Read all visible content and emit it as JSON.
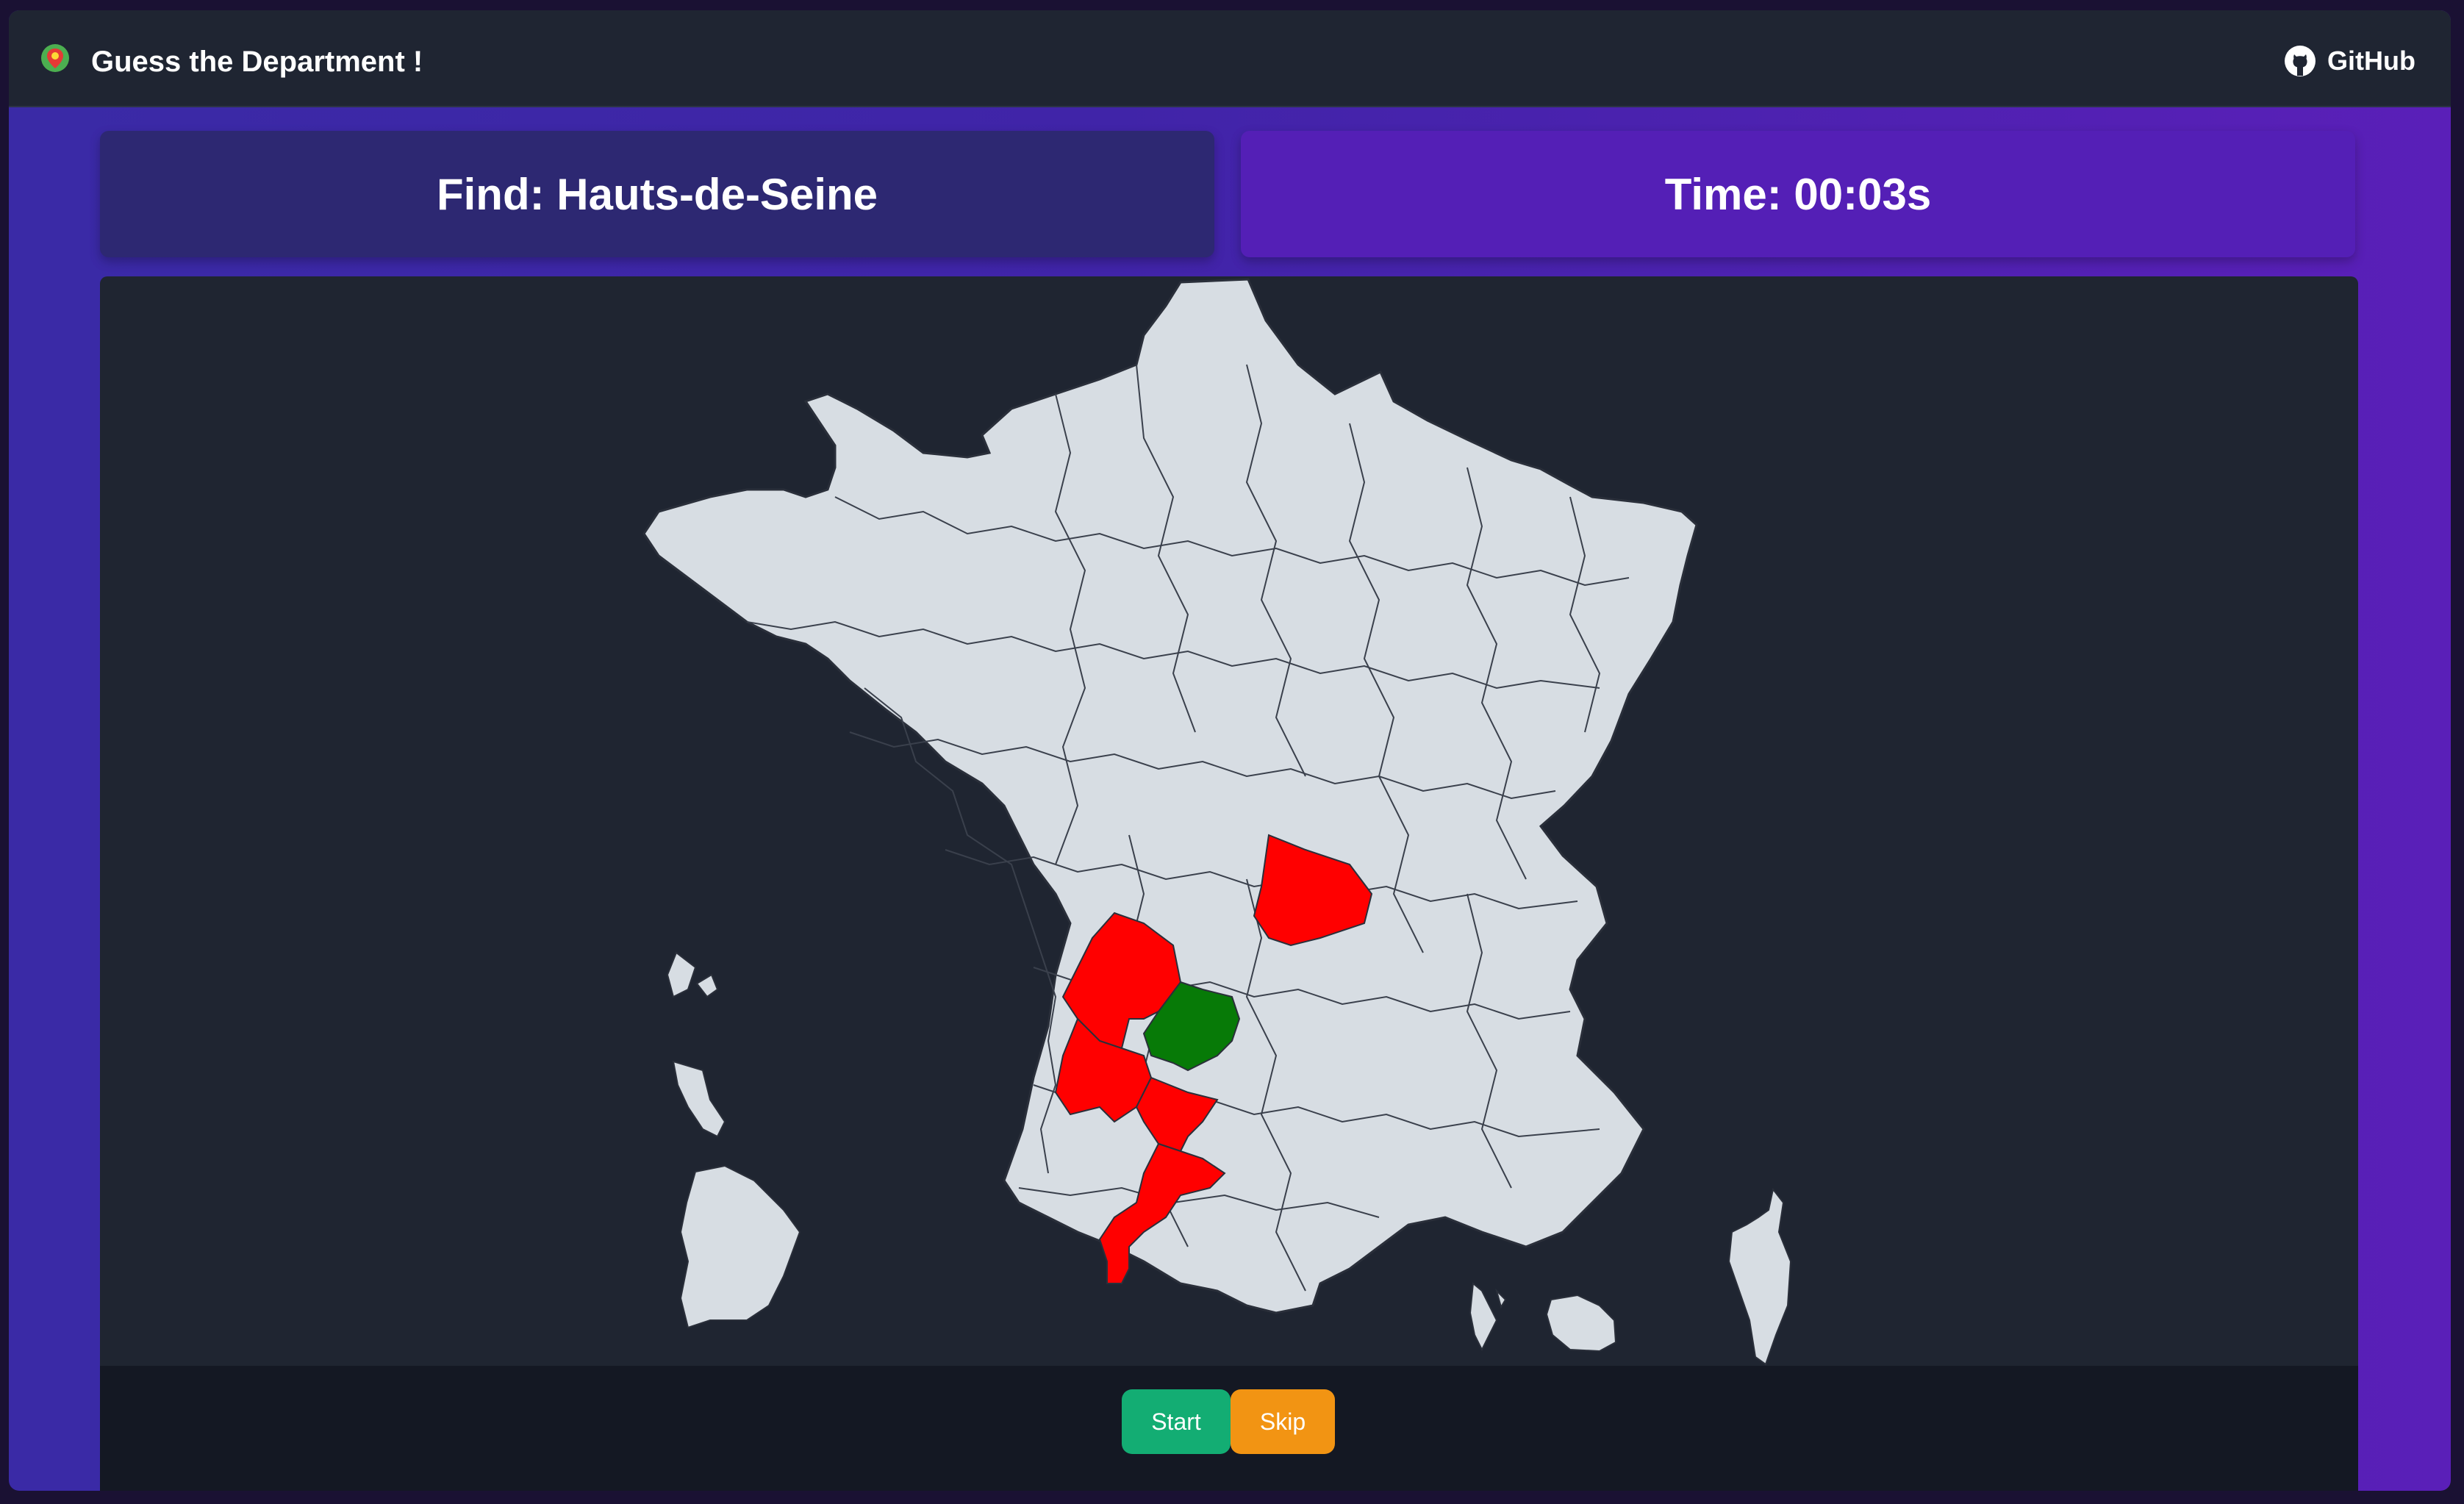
{
  "header": {
    "title": "Guess the Department !",
    "github_label": "GitHub"
  },
  "game": {
    "find_label": "Find: Hauts-de-Seine",
    "time_label": "Time: 00:03s"
  },
  "map": {
    "land_color": "#d7dde3",
    "border_color": "#2a2f3a",
    "wrong_color": "#ff0000",
    "correct_color": "#077a07",
    "highlighted": [
      {
        "name": "wrong-department-1",
        "status": "wrong"
      },
      {
        "name": "wrong-department-2",
        "status": "wrong"
      },
      {
        "name": "wrong-department-3",
        "status": "wrong"
      },
      {
        "name": "wrong-department-4",
        "status": "wrong"
      },
      {
        "name": "wrong-department-5",
        "status": "wrong"
      },
      {
        "name": "correct-department",
        "status": "correct"
      }
    ]
  },
  "controls": {
    "start_label": "Start",
    "skip_label": "Skip",
    "start_color": "#13ad73",
    "skip_color": "#f29413"
  },
  "icons": {
    "brand": "map-pin-icon",
    "github": "github-icon"
  }
}
